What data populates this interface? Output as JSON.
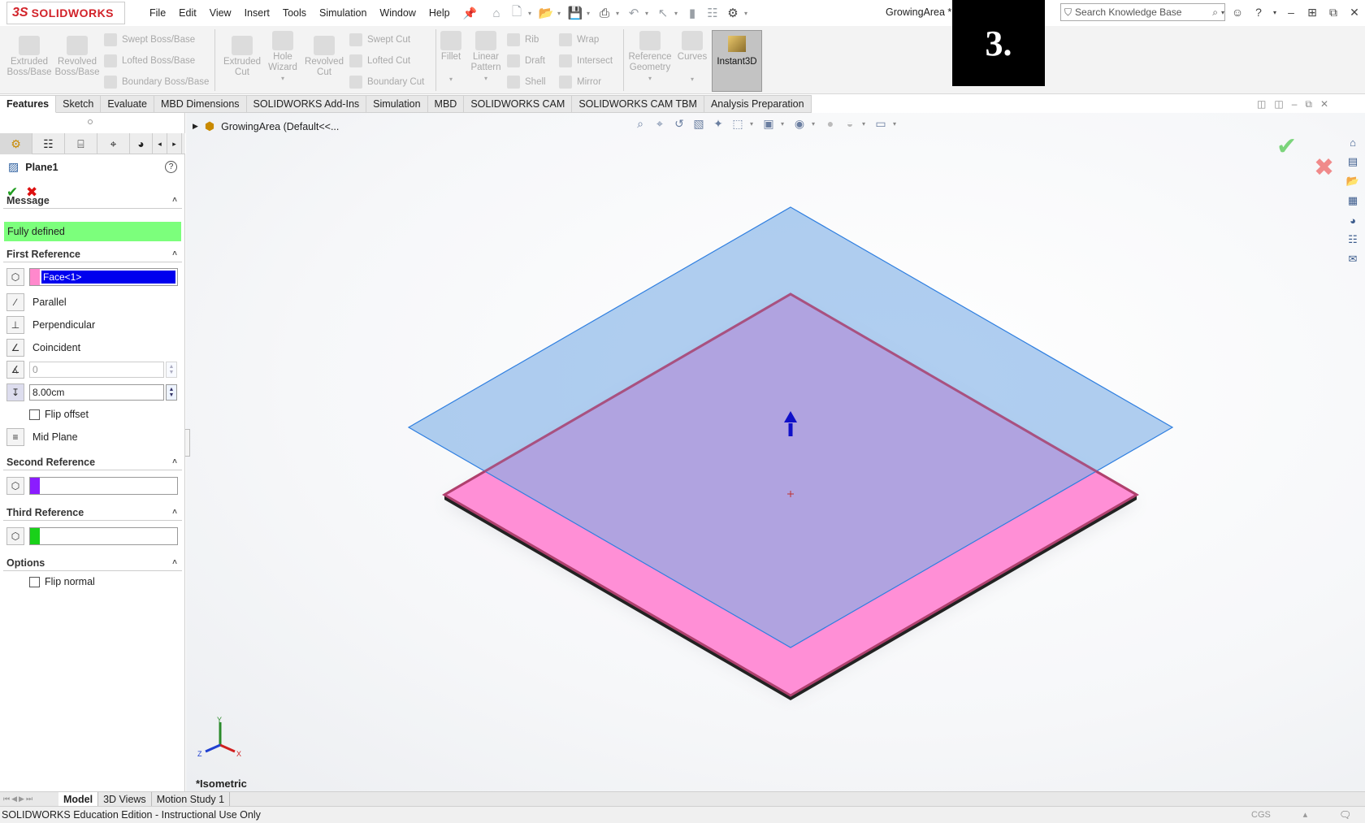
{
  "app": {
    "logo_ds": "3S",
    "logo_text": "SOLIDWORKS",
    "doc_title": "GrowingArea *"
  },
  "menu": [
    "File",
    "Edit",
    "View",
    "Insert",
    "Tools",
    "Simulation",
    "Window",
    "Help"
  ],
  "step_badge": "3.",
  "search": {
    "placeholder": "Search Knowledge Base"
  },
  "ribbon": {
    "extruded_boss": "Extruded Boss/Base",
    "revolved_boss": "Revolved Boss/Base",
    "swept_boss": "Swept Boss/Base",
    "lofted_boss": "Lofted Boss/Base",
    "boundary_boss": "Boundary Boss/Base",
    "extruded_cut": "Extruded Cut",
    "hole_wizard": "Hole Wizard",
    "revolved_cut": "Revolved Cut",
    "swept_cut": "Swept Cut",
    "lofted_cut": "Lofted Cut",
    "boundary_cut": "Boundary Cut",
    "fillet": "Fillet",
    "linear_pattern": "Linear Pattern",
    "rib": "Rib",
    "draft": "Draft",
    "shell": "Shell",
    "wrap": "Wrap",
    "intersect": "Intersect",
    "mirror": "Mirror",
    "reference_geometry": "Reference Geometry",
    "curves": "Curves",
    "instant3d": "Instant3D"
  },
  "cm_tabs": [
    "Features",
    "Sketch",
    "Evaluate",
    "MBD Dimensions",
    "SOLIDWORKS Add-Ins",
    "Simulation",
    "MBD",
    "SOLIDWORKS CAM",
    "SOLIDWORKS CAM TBM",
    "Analysis Preparation"
  ],
  "panel": {
    "title": "Plane1",
    "help": "?",
    "message": {
      "header": "Message",
      "text": "Fully defined"
    },
    "first_ref": {
      "header": "First Reference",
      "selection": "Face<1>",
      "swatch_color": "#ff88cc",
      "parallel": "Parallel",
      "perpendicular": "Perpendicular",
      "coincident": "Coincident",
      "angle_value": "0",
      "offset_value": "8.00cm",
      "flip_offset": "Flip offset",
      "mid_plane": "Mid Plane"
    },
    "second_ref": {
      "header": "Second Reference",
      "swatch_color": "#8b1cff"
    },
    "third_ref": {
      "header": "Third Reference",
      "swatch_color": "#19d119"
    },
    "options": {
      "header": "Options",
      "flip_normal": "Flip normal"
    }
  },
  "viewport": {
    "tree_root": "GrowingArea  (Default<<...",
    "view_label": "*Isometric",
    "colors": {
      "plane": "#7fb0e6",
      "face": "#ff8fd6",
      "edge": "#b0406e",
      "arrow": "#1010c8"
    }
  },
  "triad": {
    "x": "X",
    "y": "Y",
    "z": "Z"
  },
  "bottom_tabs": [
    "Model",
    "3D Views",
    "Motion Study 1"
  ],
  "status": {
    "text": "SOLIDWORKS Education Edition - Instructional Use Only",
    "units": "CGS"
  }
}
